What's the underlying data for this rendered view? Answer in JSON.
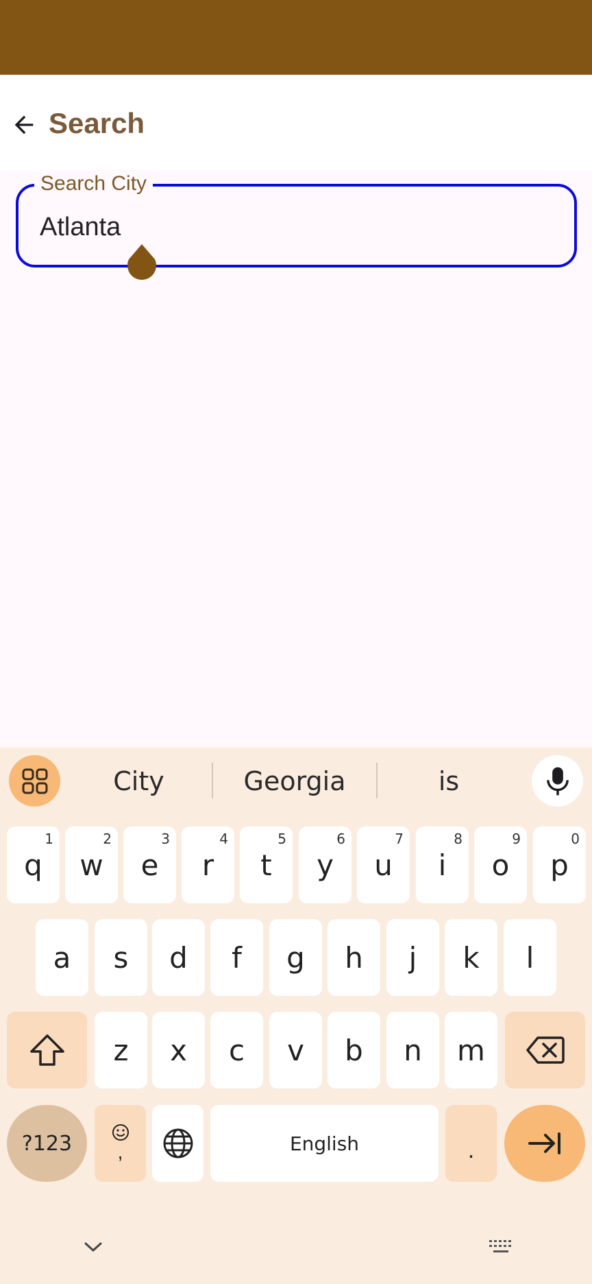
{
  "app_bar": {
    "title": "Search"
  },
  "search_field": {
    "label": "Search City",
    "value": "Atlanta"
  },
  "keyboard": {
    "suggestions": [
      "City",
      "Georgia",
      "is"
    ],
    "row1": [
      {
        "key": "q",
        "hint": "1"
      },
      {
        "key": "w",
        "hint": "2"
      },
      {
        "key": "e",
        "hint": "3"
      },
      {
        "key": "r",
        "hint": "4"
      },
      {
        "key": "t",
        "hint": "5"
      },
      {
        "key": "y",
        "hint": "6"
      },
      {
        "key": "u",
        "hint": "7"
      },
      {
        "key": "i",
        "hint": "8"
      },
      {
        "key": "o",
        "hint": "9"
      },
      {
        "key": "p",
        "hint": "0"
      }
    ],
    "row2": [
      "a",
      "s",
      "d",
      "f",
      "g",
      "h",
      "j",
      "k",
      "l"
    ],
    "row3": [
      "z",
      "x",
      "c",
      "v",
      "b",
      "n",
      "m"
    ],
    "symbols_label": "?123",
    "emoji_key_bottom": ",",
    "space_label": "English",
    "period_label": "."
  },
  "colors": {
    "status_bar": "#825515",
    "accent": "#f7b975",
    "field_border": "#0b0bd9",
    "keyboard_bg": "#fbece0"
  },
  "icons": {
    "back": "arrow-left-icon",
    "apps": "grid-icon",
    "mic": "microphone-icon",
    "shift": "shift-icon",
    "backspace": "backspace-icon",
    "globe": "globe-icon",
    "enter": "tab-arrow-icon",
    "nav_down": "chevron-down-icon",
    "nav_keyboard": "keyboard-icon"
  }
}
